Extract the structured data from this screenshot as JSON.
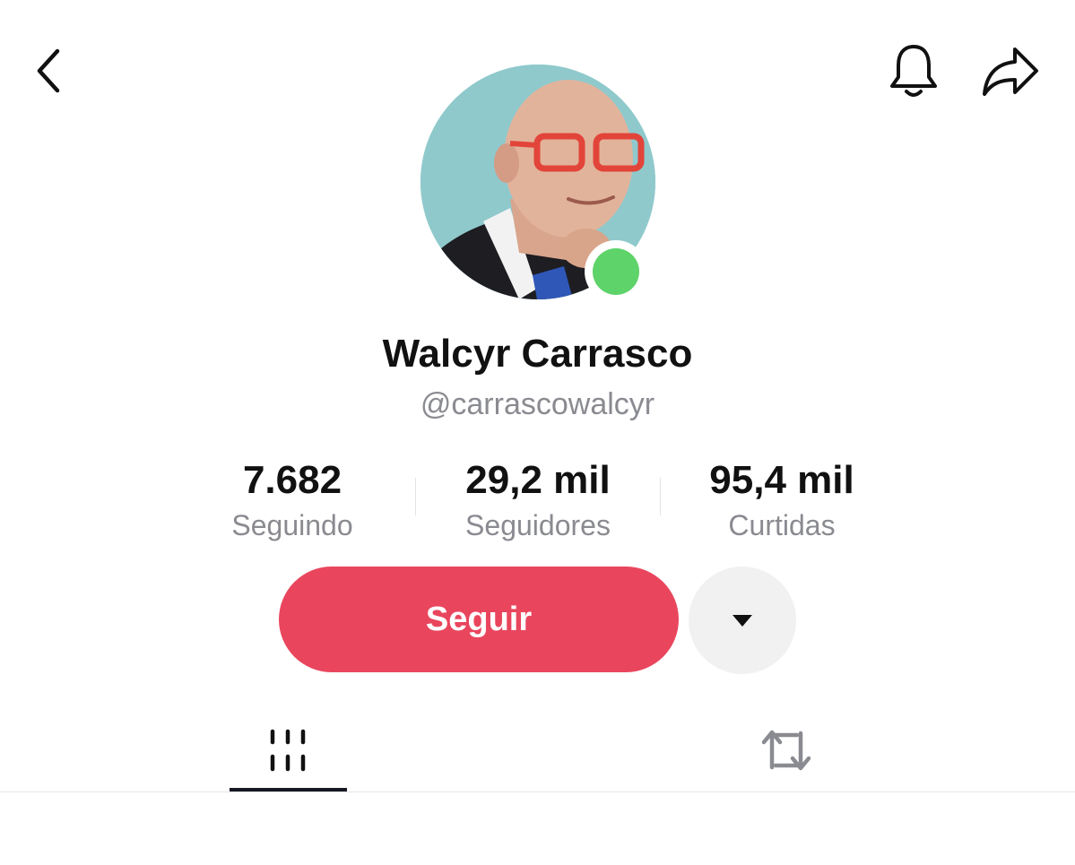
{
  "profile": {
    "name": "Walcyr Carrasco",
    "handle": "@carrascowalcyr"
  },
  "stats": [
    {
      "value": "7.682",
      "label": "Seguindo"
    },
    {
      "value": "29,2 mil",
      "label": "Seguidores"
    },
    {
      "value": "95,4 mil",
      "label": "Curtidas"
    }
  ],
  "actions": {
    "follow_label": "Seguir"
  },
  "icons": {
    "back": "chevron-left-icon",
    "notifications": "bell-icon",
    "share": "share-arrow-icon",
    "more": "caret-down-icon",
    "videos_tab": "grid-bars-icon",
    "reposts_tab": "repost-icon"
  },
  "colors": {
    "accent": "#e9465e",
    "online": "#5ed36a",
    "text_secondary": "#8a8b91"
  }
}
